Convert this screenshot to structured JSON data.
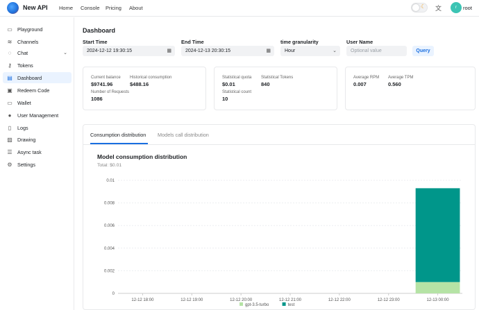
{
  "header": {
    "brand": "New API",
    "nav": [
      "Home",
      "Console",
      "Pricing",
      "About"
    ],
    "user": "root",
    "avatar_letter": "r"
  },
  "sidebar": {
    "items": [
      {
        "label": "Playground",
        "icon": "chat-bubble-icon"
      },
      {
        "label": "Channels",
        "icon": "layers-icon"
      },
      {
        "label": "Chat",
        "icon": "message-icon"
      },
      {
        "label": "Tokens",
        "icon": "key-icon"
      },
      {
        "label": "Dashboard",
        "icon": "calendar-icon"
      },
      {
        "label": "Redeem Code",
        "icon": "ticket-icon"
      },
      {
        "label": "Wallet",
        "icon": "credit-card-icon"
      },
      {
        "label": "User Management",
        "icon": "user-icon"
      },
      {
        "label": "Logs",
        "icon": "file-icon"
      },
      {
        "label": "Drawing",
        "icon": "image-icon"
      },
      {
        "label": "Async task",
        "icon": "list-icon"
      },
      {
        "label": "Settings",
        "icon": "gear-icon"
      }
    ],
    "active": "Dashboard"
  },
  "dashboard": {
    "title": "Dashboard",
    "filters": {
      "start_label": "Start Time",
      "start_value": "2024-12-12 19:30:15",
      "end_label": "End Time",
      "end_value": "2024-12-13 20:30:15",
      "granularity_label": "time granularity",
      "granularity_value": "Hour",
      "username_label": "User Name",
      "username_placeholder": "Optional value",
      "query_label": "Query"
    },
    "stats": {
      "current_balance_label": "Current balance",
      "current_balance": "$9741.96",
      "historical_label": "Historical consumption",
      "historical": "$488.16",
      "requests_label": "Number of Requests",
      "requests": "1086",
      "quota_label": "Statistical quota",
      "quota": "$0.01",
      "tokens_label": "Statistical Tokens",
      "tokens": "840",
      "count_label": "Statistical count",
      "count": "10",
      "rpm_label": "Average RPM",
      "rpm": "0.007",
      "tpm_label": "Average TPM",
      "tpm": "0.560"
    },
    "tabs": [
      "Consumption distribution",
      "Models call distribution"
    ],
    "chart_title": "Model consumption distribution",
    "chart_total": "Total:   $0.01"
  },
  "colors": {
    "accent": "#1a6fe0",
    "series_gpt": "#b5e3a5",
    "series_test": "#00968a"
  },
  "chart_data": {
    "type": "bar",
    "stacked": true,
    "categories": [
      "12-12 18:00",
      "12-12 19:00",
      "12-12 20:00",
      "12-12 21:00",
      "12-12 22:00",
      "12-12 23:00",
      "12-13 00:00"
    ],
    "series": [
      {
        "name": "gpt-3.5-turbo",
        "values": [
          0,
          0,
          0,
          0,
          0,
          0,
          0.001
        ]
      },
      {
        "name": "test",
        "values": [
          0,
          0,
          0,
          0,
          0,
          0,
          0.0083
        ]
      }
    ],
    "yticks": [
      "0",
      "0.002",
      "0.004",
      "0.006",
      "0.008",
      "0.01"
    ],
    "ylim": [
      0,
      0.01
    ],
    "legend_position": "bottom"
  }
}
